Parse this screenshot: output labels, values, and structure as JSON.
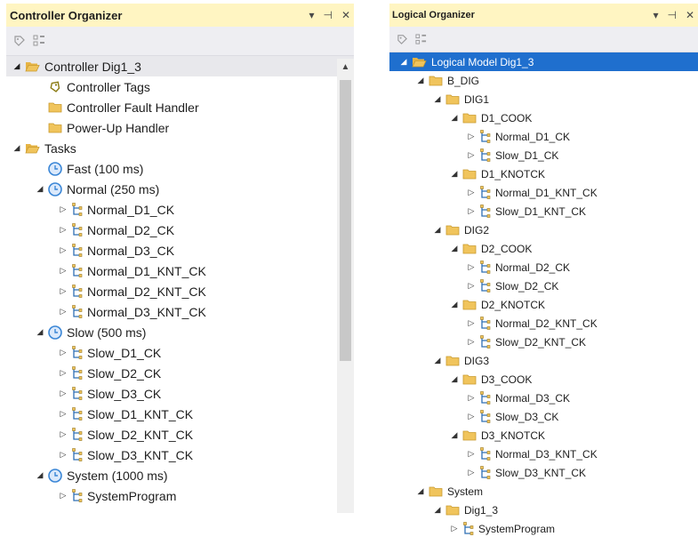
{
  "left": {
    "title": "Controller Organizer",
    "controls": {
      "dropdown": "▾",
      "pin": "⊣",
      "close": "✕"
    },
    "tree": [
      {
        "level": 0,
        "arrow": "expanded",
        "icon": "folder-open-icon",
        "text": "Controller Dig1_3",
        "selected": true
      },
      {
        "level": 1,
        "arrow": "none",
        "icon": "tag-icon",
        "text": "Controller Tags"
      },
      {
        "level": 1,
        "arrow": "none",
        "icon": "folder-icon",
        "text": "Controller Fault Handler"
      },
      {
        "level": 1,
        "arrow": "none",
        "icon": "folder-icon",
        "text": "Power-Up Handler"
      },
      {
        "level": 0,
        "arrow": "expanded",
        "icon": "folder-open-icon",
        "text": "Tasks"
      },
      {
        "level": 1,
        "arrow": "none",
        "icon": "clock-icon",
        "text": "Fast (100 ms)"
      },
      {
        "level": 1,
        "arrow": "expanded",
        "icon": "clock-icon",
        "text": "Normal (250 ms)"
      },
      {
        "level": 2,
        "arrow": "collapsed",
        "icon": "program-icon",
        "text": "Normal_D1_CK"
      },
      {
        "level": 2,
        "arrow": "collapsed",
        "icon": "program-icon",
        "text": "Normal_D2_CK"
      },
      {
        "level": 2,
        "arrow": "collapsed",
        "icon": "program-icon",
        "text": "Normal_D3_CK"
      },
      {
        "level": 2,
        "arrow": "collapsed",
        "icon": "program-icon",
        "text": "Normal_D1_KNT_CK"
      },
      {
        "level": 2,
        "arrow": "collapsed",
        "icon": "program-icon",
        "text": "Normal_D2_KNT_CK"
      },
      {
        "level": 2,
        "arrow": "collapsed",
        "icon": "program-icon",
        "text": "Normal_D3_KNT_CK"
      },
      {
        "level": 1,
        "arrow": "expanded",
        "icon": "clock-icon",
        "text": "Slow (500 ms)"
      },
      {
        "level": 2,
        "arrow": "collapsed",
        "icon": "program-icon",
        "text": "Slow_D1_CK"
      },
      {
        "level": 2,
        "arrow": "collapsed",
        "icon": "program-icon",
        "text": "Slow_D2_CK"
      },
      {
        "level": 2,
        "arrow": "collapsed",
        "icon": "program-icon",
        "text": "Slow_D3_CK"
      },
      {
        "level": 2,
        "arrow": "collapsed",
        "icon": "program-icon",
        "text": "Slow_D1_KNT_CK"
      },
      {
        "level": 2,
        "arrow": "collapsed",
        "icon": "program-icon",
        "text": "Slow_D2_KNT_CK"
      },
      {
        "level": 2,
        "arrow": "collapsed",
        "icon": "program-icon",
        "text": "Slow_D3_KNT_CK"
      },
      {
        "level": 1,
        "arrow": "expanded",
        "icon": "clock-icon",
        "text": "System (1000 ms)"
      },
      {
        "level": 2,
        "arrow": "collapsed",
        "icon": "program-icon",
        "text": "SystemProgram"
      }
    ]
  },
  "right": {
    "title": "Logical Organizer",
    "controls": {
      "dropdown": "▾",
      "pin": "⊣",
      "close": "✕"
    },
    "tree": [
      {
        "level": 0,
        "arrow": "expanded",
        "icon": "folder-open-icon",
        "text": "Logical Model Dig1_3",
        "selected": true
      },
      {
        "level": 1,
        "arrow": "expanded",
        "icon": "folder-icon",
        "text": "B_DIG"
      },
      {
        "level": 2,
        "arrow": "expanded",
        "icon": "folder-icon",
        "text": "DIG1"
      },
      {
        "level": 3,
        "arrow": "expanded",
        "icon": "folder-icon",
        "text": "D1_COOK"
      },
      {
        "level": 4,
        "arrow": "collapsed",
        "icon": "program-icon",
        "text": "Normal_D1_CK"
      },
      {
        "level": 4,
        "arrow": "collapsed",
        "icon": "program-icon",
        "text": "Slow_D1_CK"
      },
      {
        "level": 3,
        "arrow": "expanded",
        "icon": "folder-icon",
        "text": "D1_KNOTCK"
      },
      {
        "level": 4,
        "arrow": "collapsed",
        "icon": "program-icon",
        "text": "Normal_D1_KNT_CK"
      },
      {
        "level": 4,
        "arrow": "collapsed",
        "icon": "program-icon",
        "text": "Slow_D1_KNT_CK"
      },
      {
        "level": 2,
        "arrow": "expanded",
        "icon": "folder-icon",
        "text": "DIG2"
      },
      {
        "level": 3,
        "arrow": "expanded",
        "icon": "folder-icon",
        "text": "D2_COOK"
      },
      {
        "level": 4,
        "arrow": "collapsed",
        "icon": "program-icon",
        "text": "Normal_D2_CK"
      },
      {
        "level": 4,
        "arrow": "collapsed",
        "icon": "program-icon",
        "text": "Slow_D2_CK"
      },
      {
        "level": 3,
        "arrow": "expanded",
        "icon": "folder-icon",
        "text": "D2_KNOTCK"
      },
      {
        "level": 4,
        "arrow": "collapsed",
        "icon": "program-icon",
        "text": "Normal_D2_KNT_CK"
      },
      {
        "level": 4,
        "arrow": "collapsed",
        "icon": "program-icon",
        "text": "Slow_D2_KNT_CK"
      },
      {
        "level": 2,
        "arrow": "expanded",
        "icon": "folder-icon",
        "text": "DIG3"
      },
      {
        "level": 3,
        "arrow": "expanded",
        "icon": "folder-icon",
        "text": "D3_COOK"
      },
      {
        "level": 4,
        "arrow": "collapsed",
        "icon": "program-icon",
        "text": "Normal_D3_CK"
      },
      {
        "level": 4,
        "arrow": "collapsed",
        "icon": "program-icon",
        "text": "Slow_D3_CK"
      },
      {
        "level": 3,
        "arrow": "expanded",
        "icon": "folder-icon",
        "text": "D3_KNOTCK"
      },
      {
        "level": 4,
        "arrow": "collapsed",
        "icon": "program-icon",
        "text": "Normal_D3_KNT_CK"
      },
      {
        "level": 4,
        "arrow": "collapsed",
        "icon": "program-icon",
        "text": "Slow_D3_KNT_CK"
      },
      {
        "level": 1,
        "arrow": "expanded",
        "icon": "folder-icon",
        "text": "System"
      },
      {
        "level": 2,
        "arrow": "expanded",
        "icon": "folder-icon",
        "text": "Dig1_3"
      },
      {
        "level": 3,
        "arrow": "collapsed",
        "icon": "program-icon",
        "text": "SystemProgram"
      }
    ]
  },
  "colors": {
    "title_bar": "#fff5c2",
    "toolbar": "#eeeef2",
    "selection_blue": "#1f6fce",
    "folder": "#f0c45c",
    "clock": "#3a86d6"
  }
}
